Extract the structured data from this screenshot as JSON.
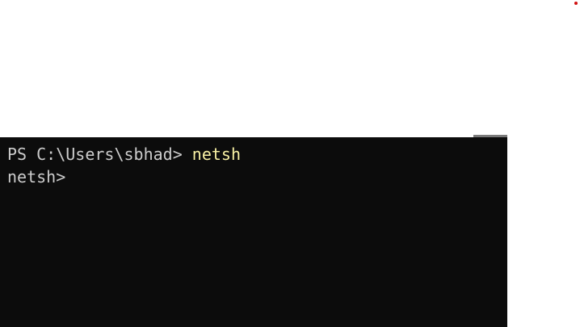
{
  "terminal": {
    "lines": [
      {
        "prompt": "PS C:\\Users\\sbhad> ",
        "command": "netsh"
      },
      {
        "prompt": "netsh>",
        "command": ""
      }
    ],
    "colors": {
      "background": "#0c0c0c",
      "text": "#cccccc",
      "command": "#f9f1a5"
    }
  }
}
